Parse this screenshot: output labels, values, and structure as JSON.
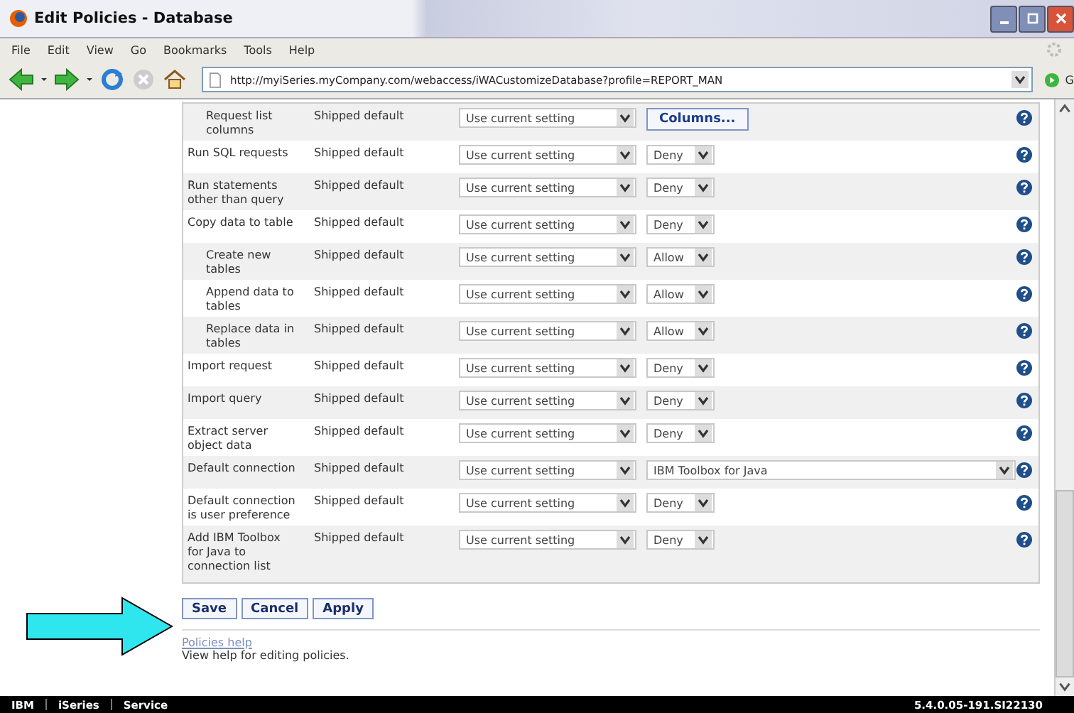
{
  "window": {
    "title": "Edit Policies - Database"
  },
  "menu": [
    "File",
    "Edit",
    "View",
    "Go",
    "Bookmarks",
    "Tools",
    "Help"
  ],
  "address": {
    "url": "http://myiSeries.myCompany.com/webaccess/iWACustomizeDatabase?profile=REPORT_MAN",
    "go_label": "G"
  },
  "rows": [
    {
      "children": [
        {
          "label": "Request list columns",
          "source": "Shipped default",
          "setting": "Use current setting",
          "kind": "button",
          "value": "Columns..."
        }
      ]
    },
    {
      "label": "Run SQL requests",
      "source": "Shipped default",
      "setting": "Use current setting",
      "kind": "select",
      "value": "Deny"
    },
    {
      "label": "Run statements other than query",
      "source": "Shipped default",
      "setting": "Use current setting",
      "kind": "select",
      "value": "Deny"
    },
    {
      "label": "Copy data to table",
      "source": "Shipped default",
      "setting": "Use current setting",
      "kind": "select",
      "value": "Deny",
      "children": [
        {
          "label": "Create new tables",
          "source": "Shipped default",
          "setting": "Use current setting",
          "kind": "select",
          "value": "Allow"
        },
        {
          "label": "Append data to tables",
          "source": "Shipped default",
          "setting": "Use current setting",
          "kind": "select",
          "value": "Allow"
        },
        {
          "label": "Replace data in tables",
          "source": "Shipped default",
          "setting": "Use current setting",
          "kind": "select",
          "value": "Allow"
        }
      ]
    },
    {
      "label": "Import request",
      "source": "Shipped default",
      "setting": "Use current setting",
      "kind": "select",
      "value": "Deny"
    },
    {
      "label": "Import query",
      "source": "Shipped default",
      "setting": "Use current setting",
      "kind": "select",
      "value": "Deny"
    },
    {
      "label": "Extract server object data",
      "source": "Shipped default",
      "setting": "Use current setting",
      "kind": "select",
      "value": "Deny"
    },
    {
      "label": "Default connection",
      "source": "Shipped default",
      "setting": "Use current setting",
      "kind": "wide-select",
      "value": "IBM Toolbox for Java"
    },
    {
      "label": "Default connection is user preference",
      "source": "Shipped default",
      "setting": "Use current setting",
      "kind": "select",
      "value": "Deny"
    },
    {
      "label": "Add IBM Toolbox for Java to connection list",
      "source": "Shipped default",
      "setting": "Use current setting",
      "kind": "select",
      "value": "Deny"
    }
  ],
  "buttons": [
    "Save",
    "Cancel",
    "Apply"
  ],
  "help": {
    "link": "Policies help",
    "text": "View help for editing policies."
  },
  "footer": {
    "links": [
      "IBM",
      "iSeries",
      "Service"
    ],
    "version": "5.4.0.05-191.SI22130"
  }
}
